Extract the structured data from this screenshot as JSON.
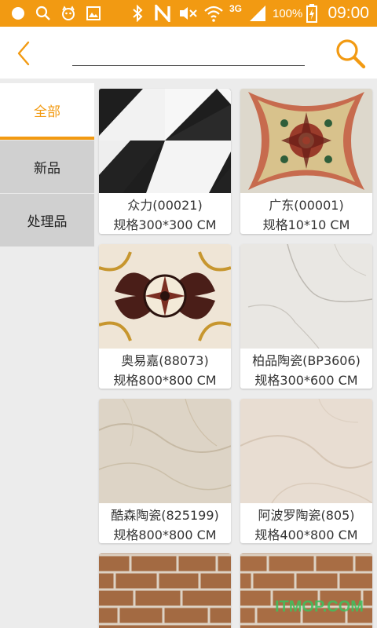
{
  "status_bar": {
    "battery_percent": "100%",
    "network": "3G",
    "time": "09:00",
    "icons": [
      "circle-icon",
      "search-icon",
      "cat-icon",
      "image-icon",
      "bluetooth-icon",
      "nfc-icon",
      "muted-icon",
      "wifi-icon",
      "signal-icon",
      "battery-icon"
    ]
  },
  "header": {
    "back_icon": "chevron-left-icon",
    "search_placeholder": "",
    "search_icon": "magnifier-icon"
  },
  "colors": {
    "accent": "#f29a12",
    "sidebar_inactive": "#d0d0d0",
    "background": "#ececec"
  },
  "sidebar": {
    "items": [
      {
        "label": "全部",
        "active": true
      },
      {
        "label": "新品",
        "active": false
      },
      {
        "label": "处理品",
        "active": false
      }
    ]
  },
  "products": [
    {
      "name": "众力(00021)",
      "spec": "规格300*300 CM",
      "image": "black-white-geometric-tile"
    },
    {
      "name": "广东(00001)",
      "spec": "规格10*10 CM",
      "image": "ornate-star-medallion-tile"
    },
    {
      "name": "奥易嘉(88073)",
      "spec": "规格800*800 CM",
      "image": "floral-mosaic-tile"
    },
    {
      "name": "柏品陶瓷(BP3606)",
      "spec": "规格300*600 CM",
      "image": "white-marble-tile"
    },
    {
      "name": "酷森陶瓷(825199)",
      "spec": "规格800*800 CM",
      "image": "beige-marble-tile"
    },
    {
      "name": "阿波罗陶瓷(805)",
      "spec": "规格400*800 CM",
      "image": "cream-marble-tile"
    },
    {
      "name": "",
      "spec": "",
      "image": "brown-brick-tile"
    },
    {
      "name": "",
      "spec": "",
      "image": "brown-brick-tile"
    }
  ],
  "watermark": "ITMOP.COM"
}
